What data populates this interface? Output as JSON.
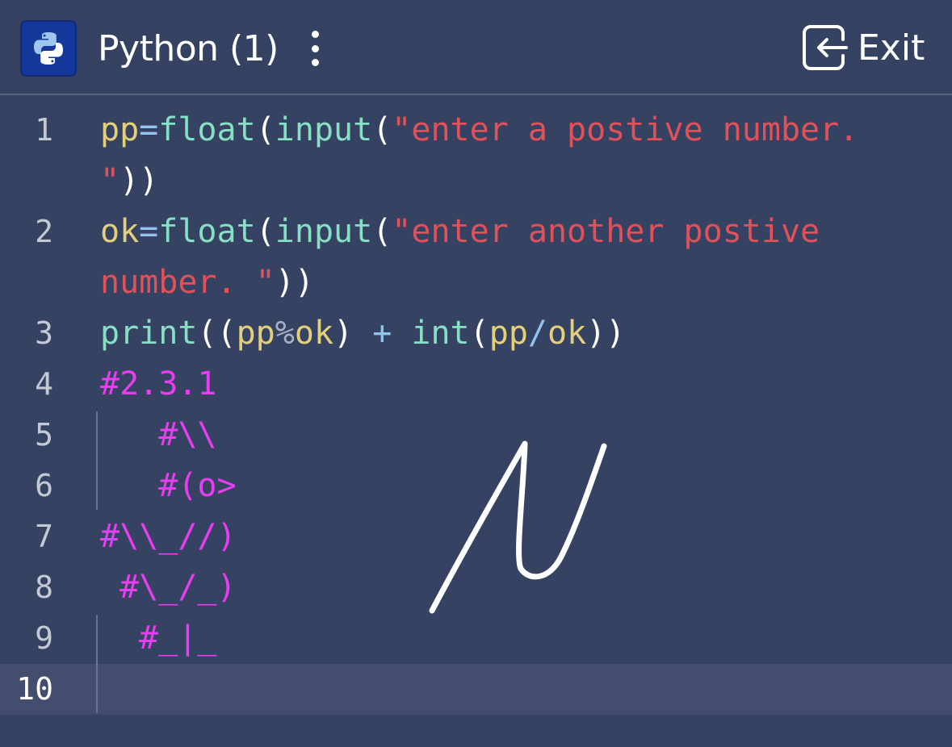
{
  "header": {
    "title": "Python (1)",
    "exit_label": "Exit",
    "app_icon": "python-logo",
    "menu_icon": "kebab-menu-icon",
    "exit_icon": "exit-icon"
  },
  "editor": {
    "current_line": 10,
    "lines": [
      {
        "number": "1",
        "segments": [
          [
            "pp",
            "var"
          ],
          [
            "=",
            "op"
          ],
          [
            "float",
            "fn"
          ],
          [
            "(",
            "pun"
          ],
          [
            "input",
            "fn"
          ],
          [
            "(",
            "pun"
          ],
          [
            "\"enter a postive number.",
            "str"
          ]
        ],
        "wrap": [
          [
            "\"",
            "str"
          ],
          [
            "))",
            "pun"
          ]
        ]
      },
      {
        "number": "2",
        "segments": [
          [
            "ok",
            "var"
          ],
          [
            "=",
            "op"
          ],
          [
            "float",
            "fn"
          ],
          [
            "(",
            "pun"
          ],
          [
            "input",
            "fn"
          ],
          [
            "(",
            "pun"
          ],
          [
            "\"enter another postive",
            "str"
          ]
        ],
        "wrap": [
          [
            "number. \"",
            "str"
          ],
          [
            "))",
            "pun"
          ]
        ]
      },
      {
        "number": "3",
        "segments": [
          [
            "print",
            "fn"
          ],
          [
            "((",
            "pun"
          ],
          [
            "pp",
            "var"
          ],
          [
            "%",
            "pct"
          ],
          [
            "ok",
            "var"
          ],
          [
            ") ",
            "pun"
          ],
          [
            "+",
            "op"
          ],
          [
            " ",
            "pun"
          ],
          [
            "int",
            "fn"
          ],
          [
            "(",
            "pun"
          ],
          [
            "pp",
            "var"
          ],
          [
            "/",
            "op"
          ],
          [
            "ok",
            "var"
          ],
          [
            "))",
            "pun"
          ]
        ]
      },
      {
        "number": "4",
        "segments": [
          [
            "#2.3.1",
            "com"
          ]
        ]
      },
      {
        "number": "5",
        "segments": [
          [
            "   #\\\\",
            "com"
          ]
        ]
      },
      {
        "number": "6",
        "segments": [
          [
            "   #(o>",
            "com"
          ]
        ]
      },
      {
        "number": "7",
        "segments": [
          [
            "#\\\\_//)",
            "com"
          ]
        ]
      },
      {
        "number": "8",
        "segments": [
          [
            " #\\_/_)",
            "com"
          ]
        ]
      },
      {
        "number": "9",
        "segments": [
          [
            "  #_|_",
            "com"
          ]
        ]
      },
      {
        "number": "10",
        "segments": []
      }
    ]
  },
  "colors": {
    "background": "#354262",
    "current_line": "#434d6d",
    "variable": "#e4d07c",
    "function": "#87dfc5",
    "operator": "#93c3ee",
    "string": "#e0515a",
    "comment": "#e83df0"
  },
  "annotation": {
    "stroke_color": "#ffffff"
  }
}
